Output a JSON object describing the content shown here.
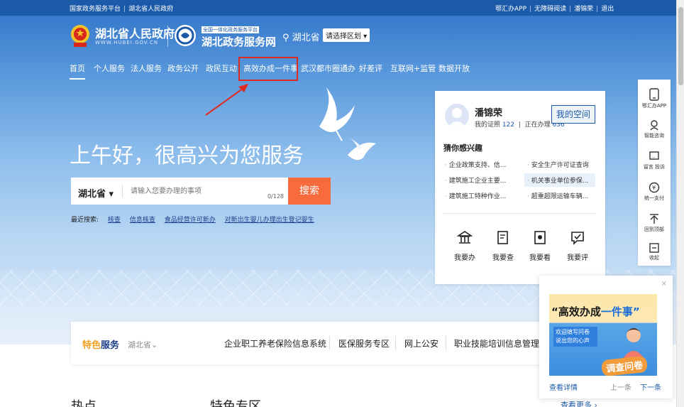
{
  "topbar": {
    "left": [
      "国家政务服务平台",
      "湖北省人民政府"
    ],
    "right": [
      "鄂汇办APP",
      "无障碍阅读",
      "潘锦荣",
      "退出"
    ]
  },
  "header": {
    "gov_name": "湖北省人民政府",
    "gov_url": "WWW.HUBEI.GOV.CN",
    "service_tag": "全国一体化政务服务平台",
    "service_name": "湖北政务服务网",
    "location": "湖北省",
    "region_button": "请选择区划 ▾"
  },
  "nav": {
    "items": [
      "首页",
      "个人服务",
      "法人服务",
      "政务公开",
      "政民互动",
      "高效办成一件事",
      "武汉都市圈通办",
      "好差评",
      "互联网+监管",
      "数据开放"
    ],
    "active_index": 0,
    "highlighted_index": 5
  },
  "hero": {
    "greeting": "上午好，很高兴为您服务"
  },
  "search": {
    "region": "湖北省 ▾",
    "placeholder": "请输入您要办理的事项",
    "count": "0/128",
    "button": "搜索",
    "recent_label": "最近搜索:",
    "recent": [
      "核查",
      "信息核查",
      "食品经营许可新办",
      "对新出生婴儿办理出生登记婴生"
    ]
  },
  "user": {
    "name": "潘锦荣",
    "cert_label": "我的证照",
    "cert_count": "122",
    "doing_label": "正在办理",
    "doing_count": "636",
    "space_button": "我的空间",
    "interest_title": "猜你感兴趣",
    "interests": [
      "企业政策支持、信...",
      "安全生产许可证查询",
      "建筑施工企业主要...",
      "机关事业单位参保...",
      "建筑施工特种作业...",
      "超重超限运输车辆..."
    ],
    "quick_actions": [
      "我要办",
      "我要查",
      "我要看",
      "我要评"
    ]
  },
  "rightbar": {
    "items": [
      {
        "label": "鄂汇办APP",
        "icon": "phone-icon"
      },
      {
        "label": "智能咨询",
        "icon": "robot-icon"
      },
      {
        "label": "留言 投诉",
        "icon": "message-icon"
      },
      {
        "label": "统一支付",
        "icon": "yuan-icon"
      },
      {
        "label": "回到顶部",
        "icon": "back-to-top-icon"
      },
      {
        "label": "收起",
        "icon": "collapse-icon"
      }
    ]
  },
  "featured": {
    "title_a": "特色",
    "title_b": "服务",
    "region": "湖北省⌄",
    "items": [
      "企业职工养老保险信息系统",
      "医保服务专区",
      "网上公安",
      "职业技能培训信息管理系统"
    ]
  },
  "bottom": {
    "hot": "热点",
    "special": "特色专区",
    "more": "查看更多 ›"
  },
  "popup": {
    "close": "×",
    "banner_title_a": "“高效办成",
    "banner_title_b": "一件事”",
    "banner_sub": "欢迎填写问卷 说出您的心声",
    "banner_cta": "调查问卷",
    "detail": "查看详情",
    "prev": "上一条",
    "next": "下一条"
  }
}
